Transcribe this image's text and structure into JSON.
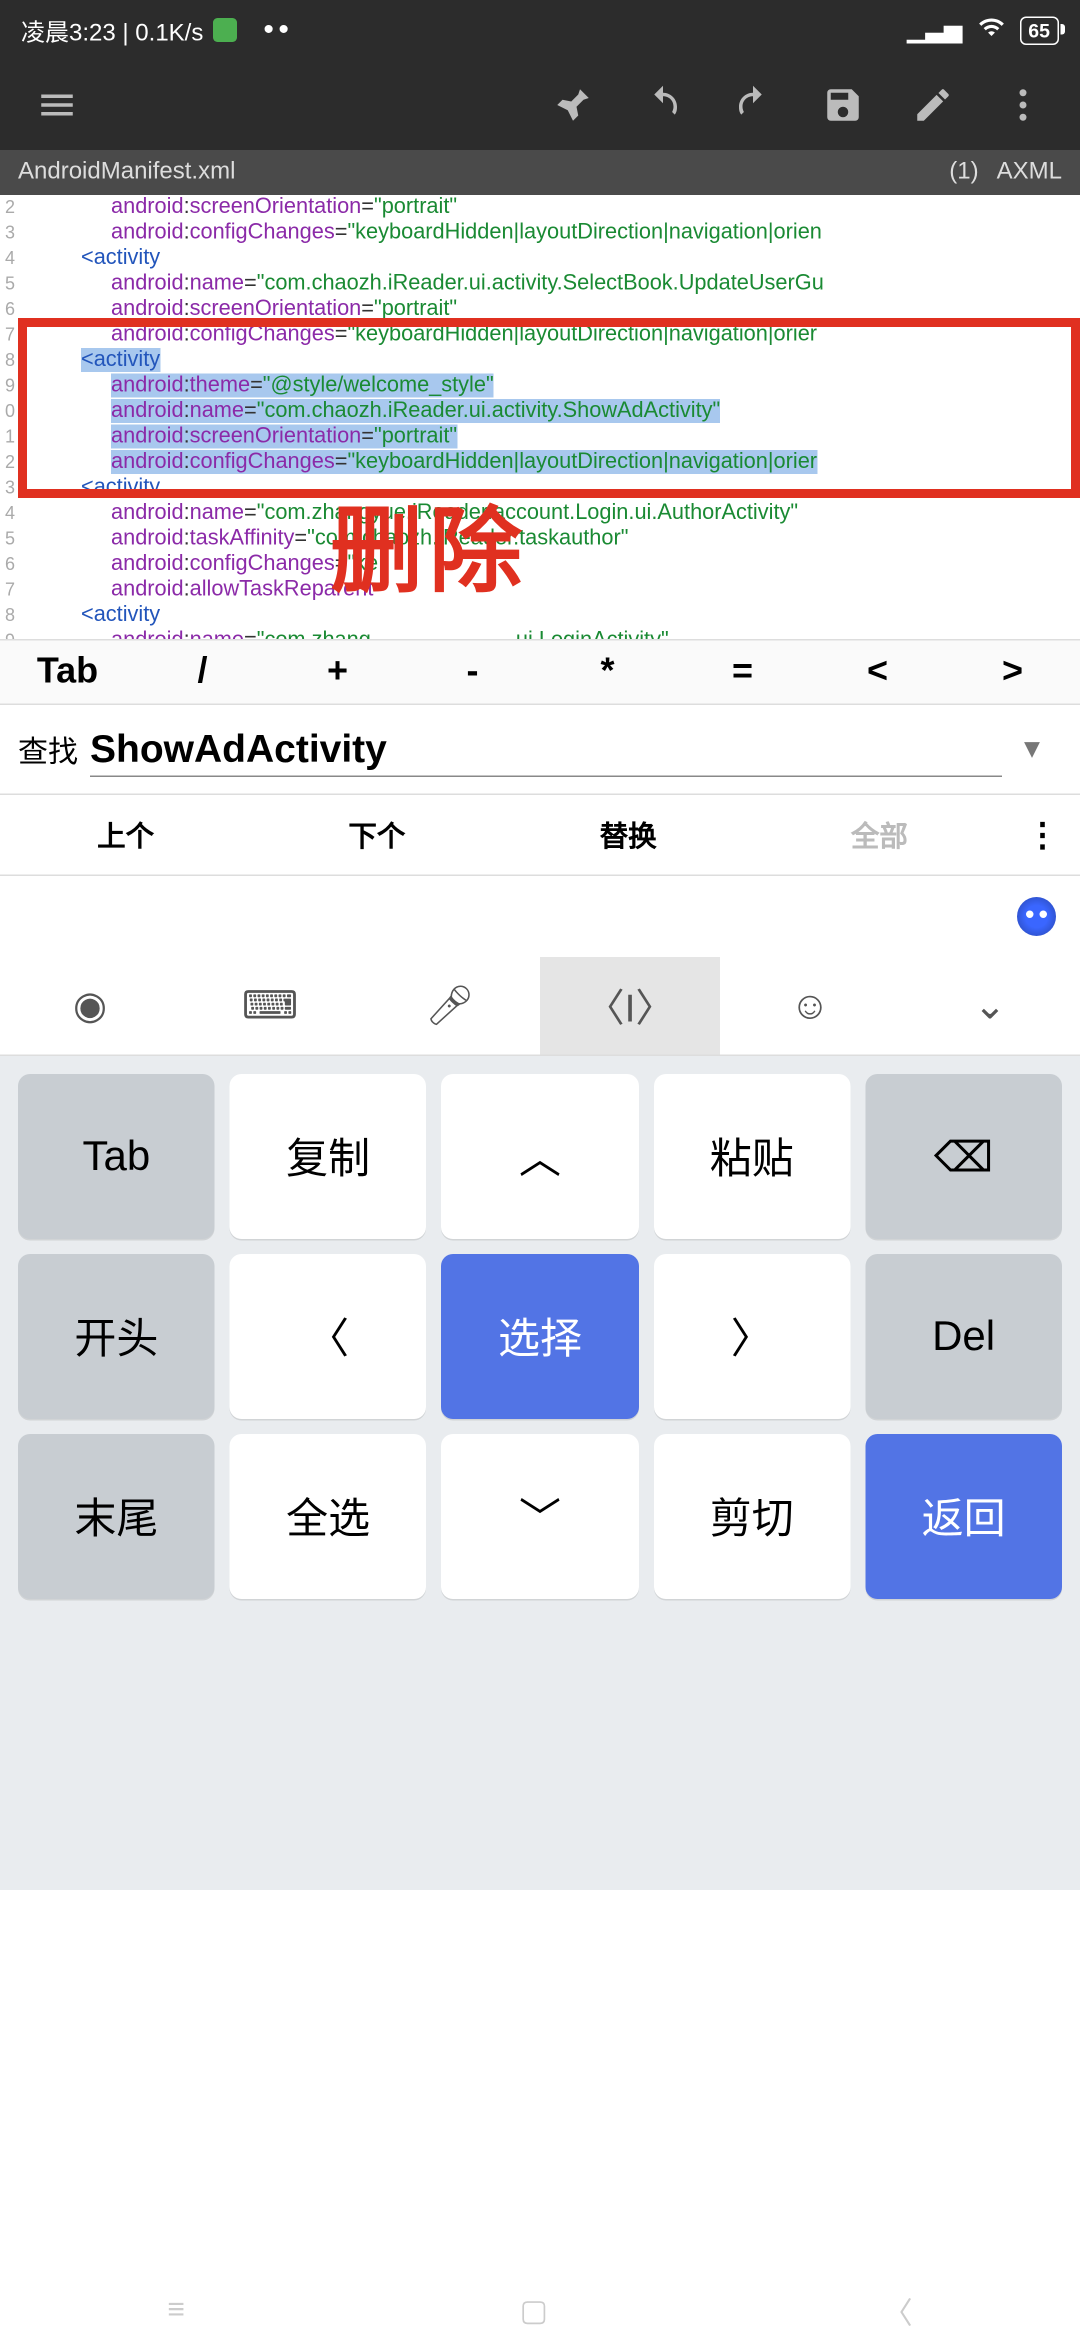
{
  "status": {
    "time_label": "凌晨3:23",
    "speed": "0.1K/s",
    "battery": "65"
  },
  "tabbar": {
    "filename": "AndroidManifest.xml",
    "count": "(1)",
    "mode": "AXML"
  },
  "gutter": [
    "2",
    "3",
    "4",
    "5",
    "6",
    "7",
    "8",
    "9",
    "0",
    "1",
    "2",
    "3",
    "4",
    "5",
    "6",
    "7",
    "8",
    "9"
  ],
  "annotation": {
    "delete_text": "删除"
  },
  "syntax": {
    "ns": "android",
    "colon": ":",
    "eq": "=",
    "tag_activity_open": "<activity",
    "attrs": {
      "name": "name",
      "screenOrientation": "screenOrientation",
      "configChanges": "configChanges",
      "theme": "theme",
      "taskAffinity": "taskAffinity",
      "allowTaskReparent": "allowTaskReparent"
    },
    "vals": {
      "portrait": "\"portrait\"",
      "cfg": "\"keyboardHidden|layoutDirection|navigation|orien",
      "cfg2": "\"keyboardHidden|layoutDirection|navigation|orier",
      "updateUser": "\"com.chaozh.iReader.ui.activity.SelectBook.UpdateUserGu",
      "welcome": "\"@style/welcome_style\"",
      "showAd": "\"com.chaozh.iReader.ui.activity.ShowAdActivity\"",
      "author": "\"com.zhangyue.iReader.account.Login.ui.AuthorActivity\"",
      "taskAuthor": "\"com.chaozh.iReader.taskauthor\"",
      "cfgcut": "\"ke",
      "login": "\"com.zhang",
      "login2": "ui.LoginActivity\""
    }
  },
  "symrow": [
    "Tab",
    "/",
    "+",
    "-",
    "*",
    "=",
    "<",
    ">"
  ],
  "find": {
    "label": "查找",
    "value": "ShowAdActivity",
    "prev": "上个",
    "next": "下个",
    "replace": "替换",
    "all": "全部"
  },
  "keyboard": {
    "row1": [
      "Tab",
      "复制",
      "",
      "粘贴",
      ""
    ],
    "row2": [
      "开头",
      "",
      "选择",
      "",
      "Del"
    ],
    "row3": [
      "末尾",
      "全选",
      "",
      "剪切",
      "返回"
    ]
  }
}
